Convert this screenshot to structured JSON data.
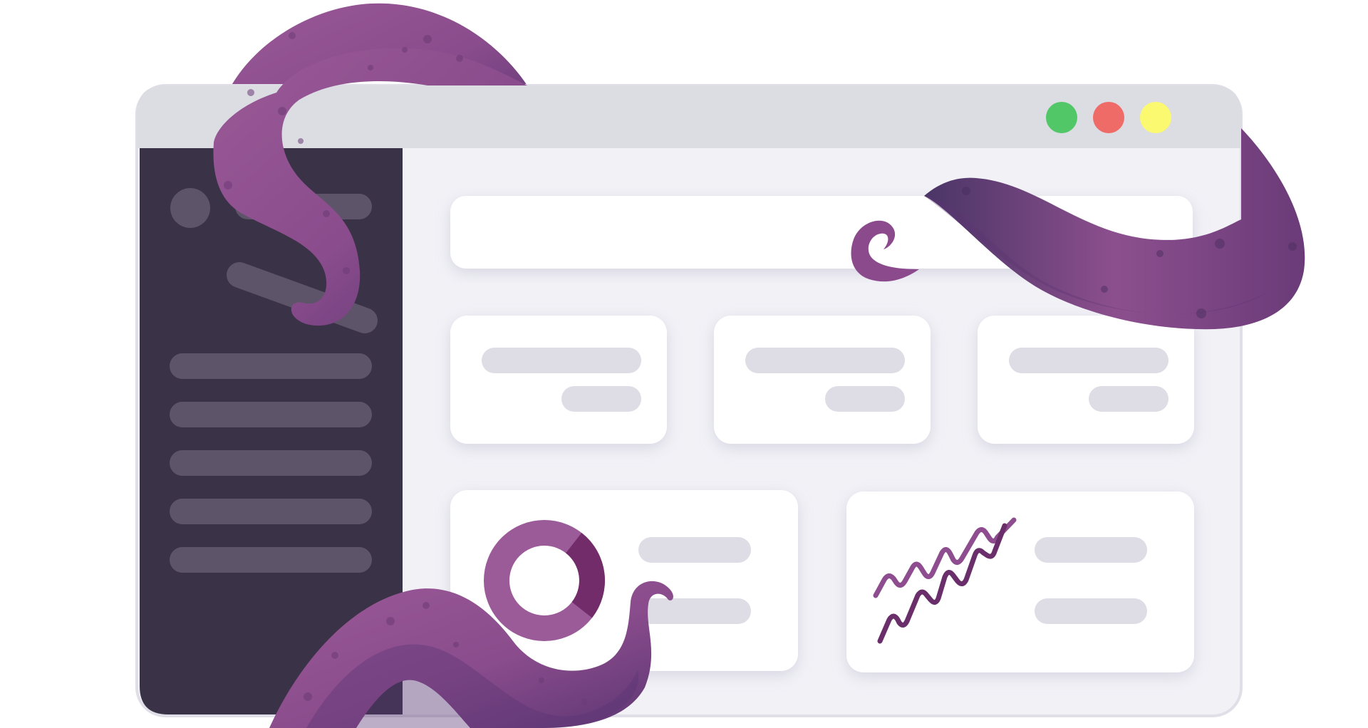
{
  "window": {
    "controls": [
      {
        "name": "green",
        "color": "#52c767"
      },
      {
        "name": "red",
        "color": "#ef6b67"
      },
      {
        "name": "yellow",
        "color": "#fbf96f"
      }
    ]
  },
  "colors": {
    "titlebar": "#dcdce3",
    "sidebar": "#3a3247",
    "sidebar_item": "#5e5469",
    "content_bg": "#f1f1f6",
    "card": "#ffffff",
    "placeholder": "#dedde5",
    "tentacle": "#8e4d8e",
    "tentacle_dark": "#5d3470",
    "chart_line": "#8e4d8e",
    "chart_line_dark": "#6a2f6a"
  },
  "icons": {
    "sidebar_avatar": "avatar-circle-icon",
    "donut": "donut-chart-icon",
    "sparkline": "line-chart-icon",
    "tentacle": "tentacle-illustration"
  },
  "chart_widgets": {
    "donut": {
      "main_share_percent": 75
    }
  }
}
